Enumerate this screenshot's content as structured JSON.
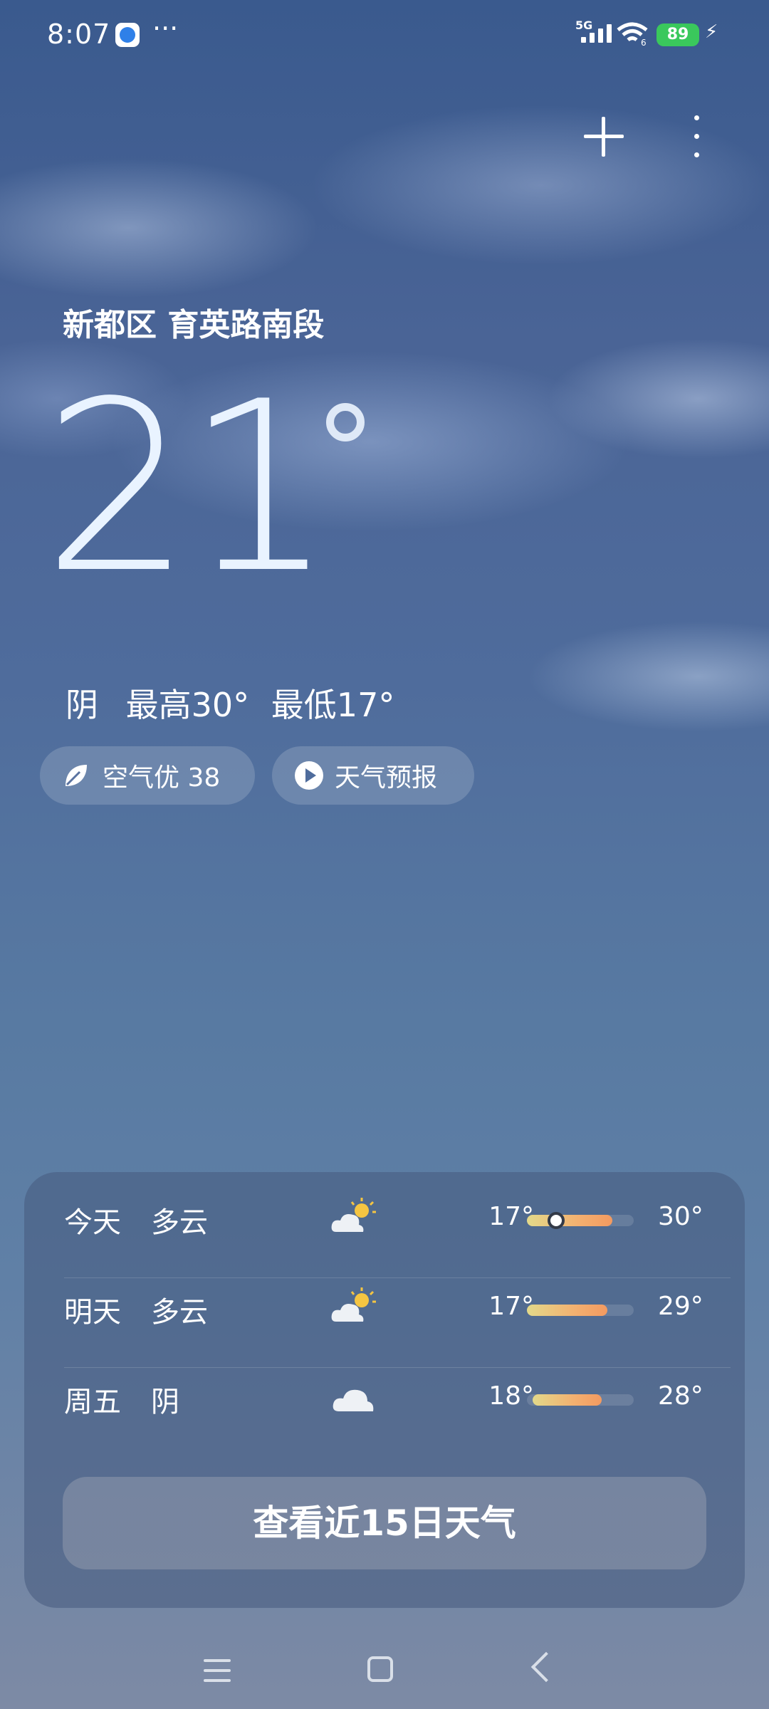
{
  "status_bar": {
    "time": "8:07",
    "more": "···",
    "network": "5G",
    "wifi_tag": "6",
    "battery": "89"
  },
  "toolbar": {
    "add_icon": "plus-icon",
    "more_icon": "vertical-dots-icon"
  },
  "current": {
    "location": "新都区 育英路南段",
    "temperature": "21",
    "condition": "阴",
    "high": "最高30°",
    "low": "最低17°"
  },
  "chips": {
    "air_quality": "空气优 38",
    "forecast": "天气预报"
  },
  "forecast": {
    "days": [
      {
        "day": "今天",
        "condition": "多云",
        "icon": "partly-cloudy-icon",
        "low": "17°",
        "high": "30°",
        "range": [
          0.0,
          0.8
        ],
        "current_marker": 0.27
      },
      {
        "day": "明天",
        "condition": "多云",
        "icon": "partly-cloudy-icon",
        "low": "17°",
        "high": "29°",
        "range": [
          0.0,
          0.75
        ]
      },
      {
        "day": "周五",
        "condition": "阴",
        "icon": "cloudy-icon",
        "low": "18°",
        "high": "28°",
        "range": [
          0.05,
          0.7
        ]
      }
    ],
    "cta_label": "查看近15日天气"
  },
  "colors": {
    "battery": "#3ac85c",
    "bar_start": "#e3d98a",
    "bar_end": "#f39a60"
  }
}
